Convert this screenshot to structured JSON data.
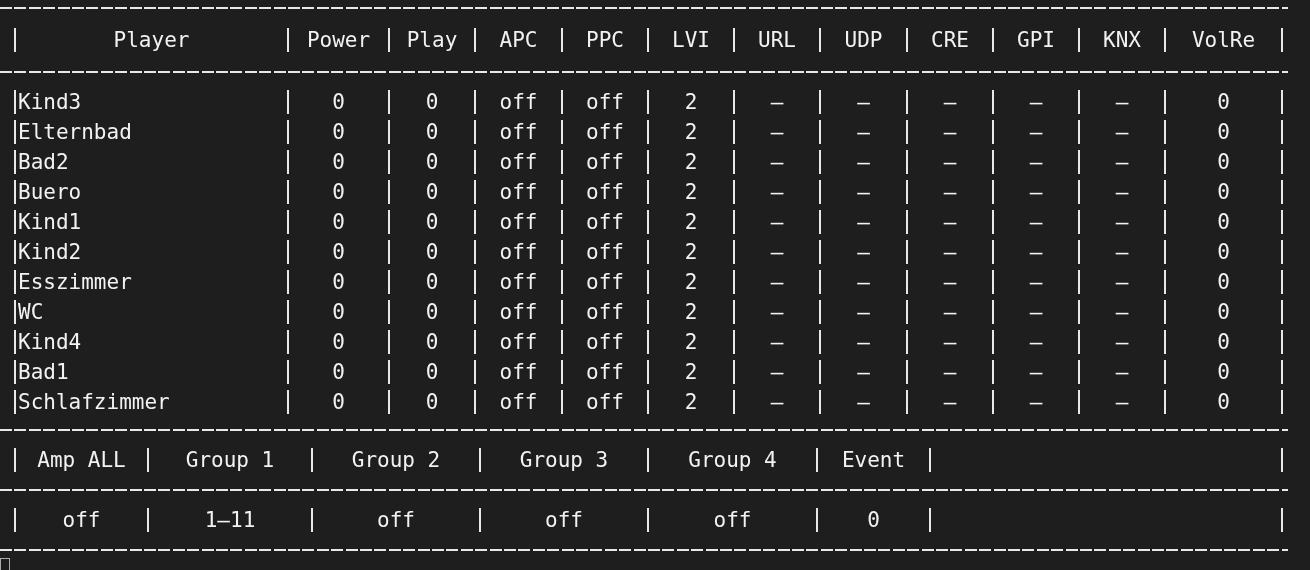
{
  "players_table": {
    "columns": [
      "Player",
      "Power",
      "Play",
      "APC",
      "PPC",
      "LVI",
      "URL",
      "UDP",
      "CRE",
      "GPI",
      "KNX",
      "VolRe"
    ],
    "rows": [
      [
        "Kind3",
        "0",
        "0",
        "off",
        "off",
        "2",
        "–",
        "–",
        "–",
        "–",
        "–",
        "0"
      ],
      [
        "Elternbad",
        "0",
        "0",
        "off",
        "off",
        "2",
        "–",
        "–",
        "–",
        "–",
        "–",
        "0"
      ],
      [
        "Bad2",
        "0",
        "0",
        "off",
        "off",
        "2",
        "–",
        "–",
        "–",
        "–",
        "–",
        "0"
      ],
      [
        "Buero",
        "0",
        "0",
        "off",
        "off",
        "2",
        "–",
        "–",
        "–",
        "–",
        "–",
        "0"
      ],
      [
        "Kind1",
        "0",
        "0",
        "off",
        "off",
        "2",
        "–",
        "–",
        "–",
        "–",
        "–",
        "0"
      ],
      [
        "Kind2",
        "0",
        "0",
        "off",
        "off",
        "2",
        "–",
        "–",
        "–",
        "–",
        "–",
        "0"
      ],
      [
        "Esszimmer",
        "0",
        "0",
        "off",
        "off",
        "2",
        "–",
        "–",
        "–",
        "–",
        "–",
        "0"
      ],
      [
        "WC",
        "0",
        "0",
        "off",
        "off",
        "2",
        "–",
        "–",
        "–",
        "–",
        "–",
        "0"
      ],
      [
        "Kind4",
        "0",
        "0",
        "off",
        "off",
        "2",
        "–",
        "–",
        "–",
        "–",
        "–",
        "0"
      ],
      [
        "Bad1",
        "0",
        "0",
        "off",
        "off",
        "2",
        "–",
        "–",
        "–",
        "–",
        "–",
        "0"
      ],
      [
        "Schlafzimmer",
        "0",
        "0",
        "off",
        "off",
        "2",
        "–",
        "–",
        "–",
        "–",
        "–",
        "0"
      ]
    ]
  },
  "groups_table": {
    "columns": [
      "Amp ALL",
      "Group 1",
      "Group 2",
      "Group 3",
      "Group 4",
      "Event"
    ],
    "values": [
      "off",
      "1–11",
      "off",
      "off",
      "off",
      "0"
    ]
  }
}
